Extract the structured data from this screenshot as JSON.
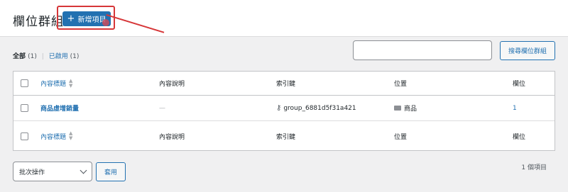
{
  "header": {
    "title": "欄位群組",
    "add_new_label": "新增項目",
    "add_new_icon": "plus-icon"
  },
  "filters": {
    "all_label": "全部",
    "all_count": "(1)",
    "separator": "|",
    "active_label": "已啟用",
    "active_count": "(1)"
  },
  "search": {
    "placeholder": "",
    "button_label": "搜尋欄位群組"
  },
  "table": {
    "columns": {
      "title": "內容標題",
      "description": "內容說明",
      "key": "索引鍵",
      "location": "位置",
      "fields": "欄位"
    },
    "rows": [
      {
        "title": "商品虛增銷量",
        "description": "—",
        "key_icon": "key-icon",
        "key": "group_6881d5f31a421",
        "location_icon": "product-icon",
        "location": "商品",
        "fields": "1"
      }
    ]
  },
  "bulk": {
    "select_label": "批次操作",
    "apply_label": "套用"
  },
  "pagination": {
    "items_count": "1 個項目"
  },
  "colors": {
    "accent": "#2271b1",
    "highlight": "#d63638"
  }
}
